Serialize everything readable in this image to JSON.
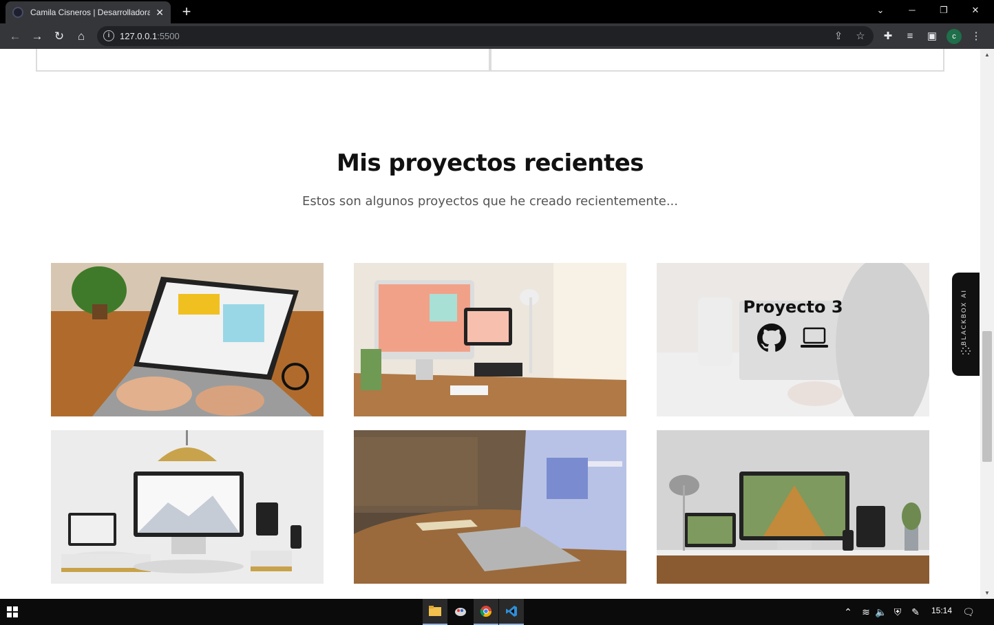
{
  "browser": {
    "tab_title": "Camila Cisneros | Desarrolladora",
    "url_host": "127.0.0.1",
    "url_port": ":5500",
    "profile_initial": "c"
  },
  "page": {
    "section_title": "Mis proyectos recientes",
    "section_subtitle": "Estos son algunos proyectos que he creado recientemente...",
    "projects": [
      {
        "hover_title": ""
      },
      {
        "hover_title": ""
      },
      {
        "hover_title": "Proyecto 3"
      },
      {
        "hover_title": ""
      },
      {
        "hover_title": ""
      },
      {
        "hover_title": ""
      }
    ],
    "blackbox_label": "BLACKBOX AI"
  },
  "taskbar": {
    "time": "15:14"
  },
  "colors": {
    "chrome_dark": "#35363a",
    "omnibox": "#202124",
    "profile": "#1e6f4a"
  }
}
